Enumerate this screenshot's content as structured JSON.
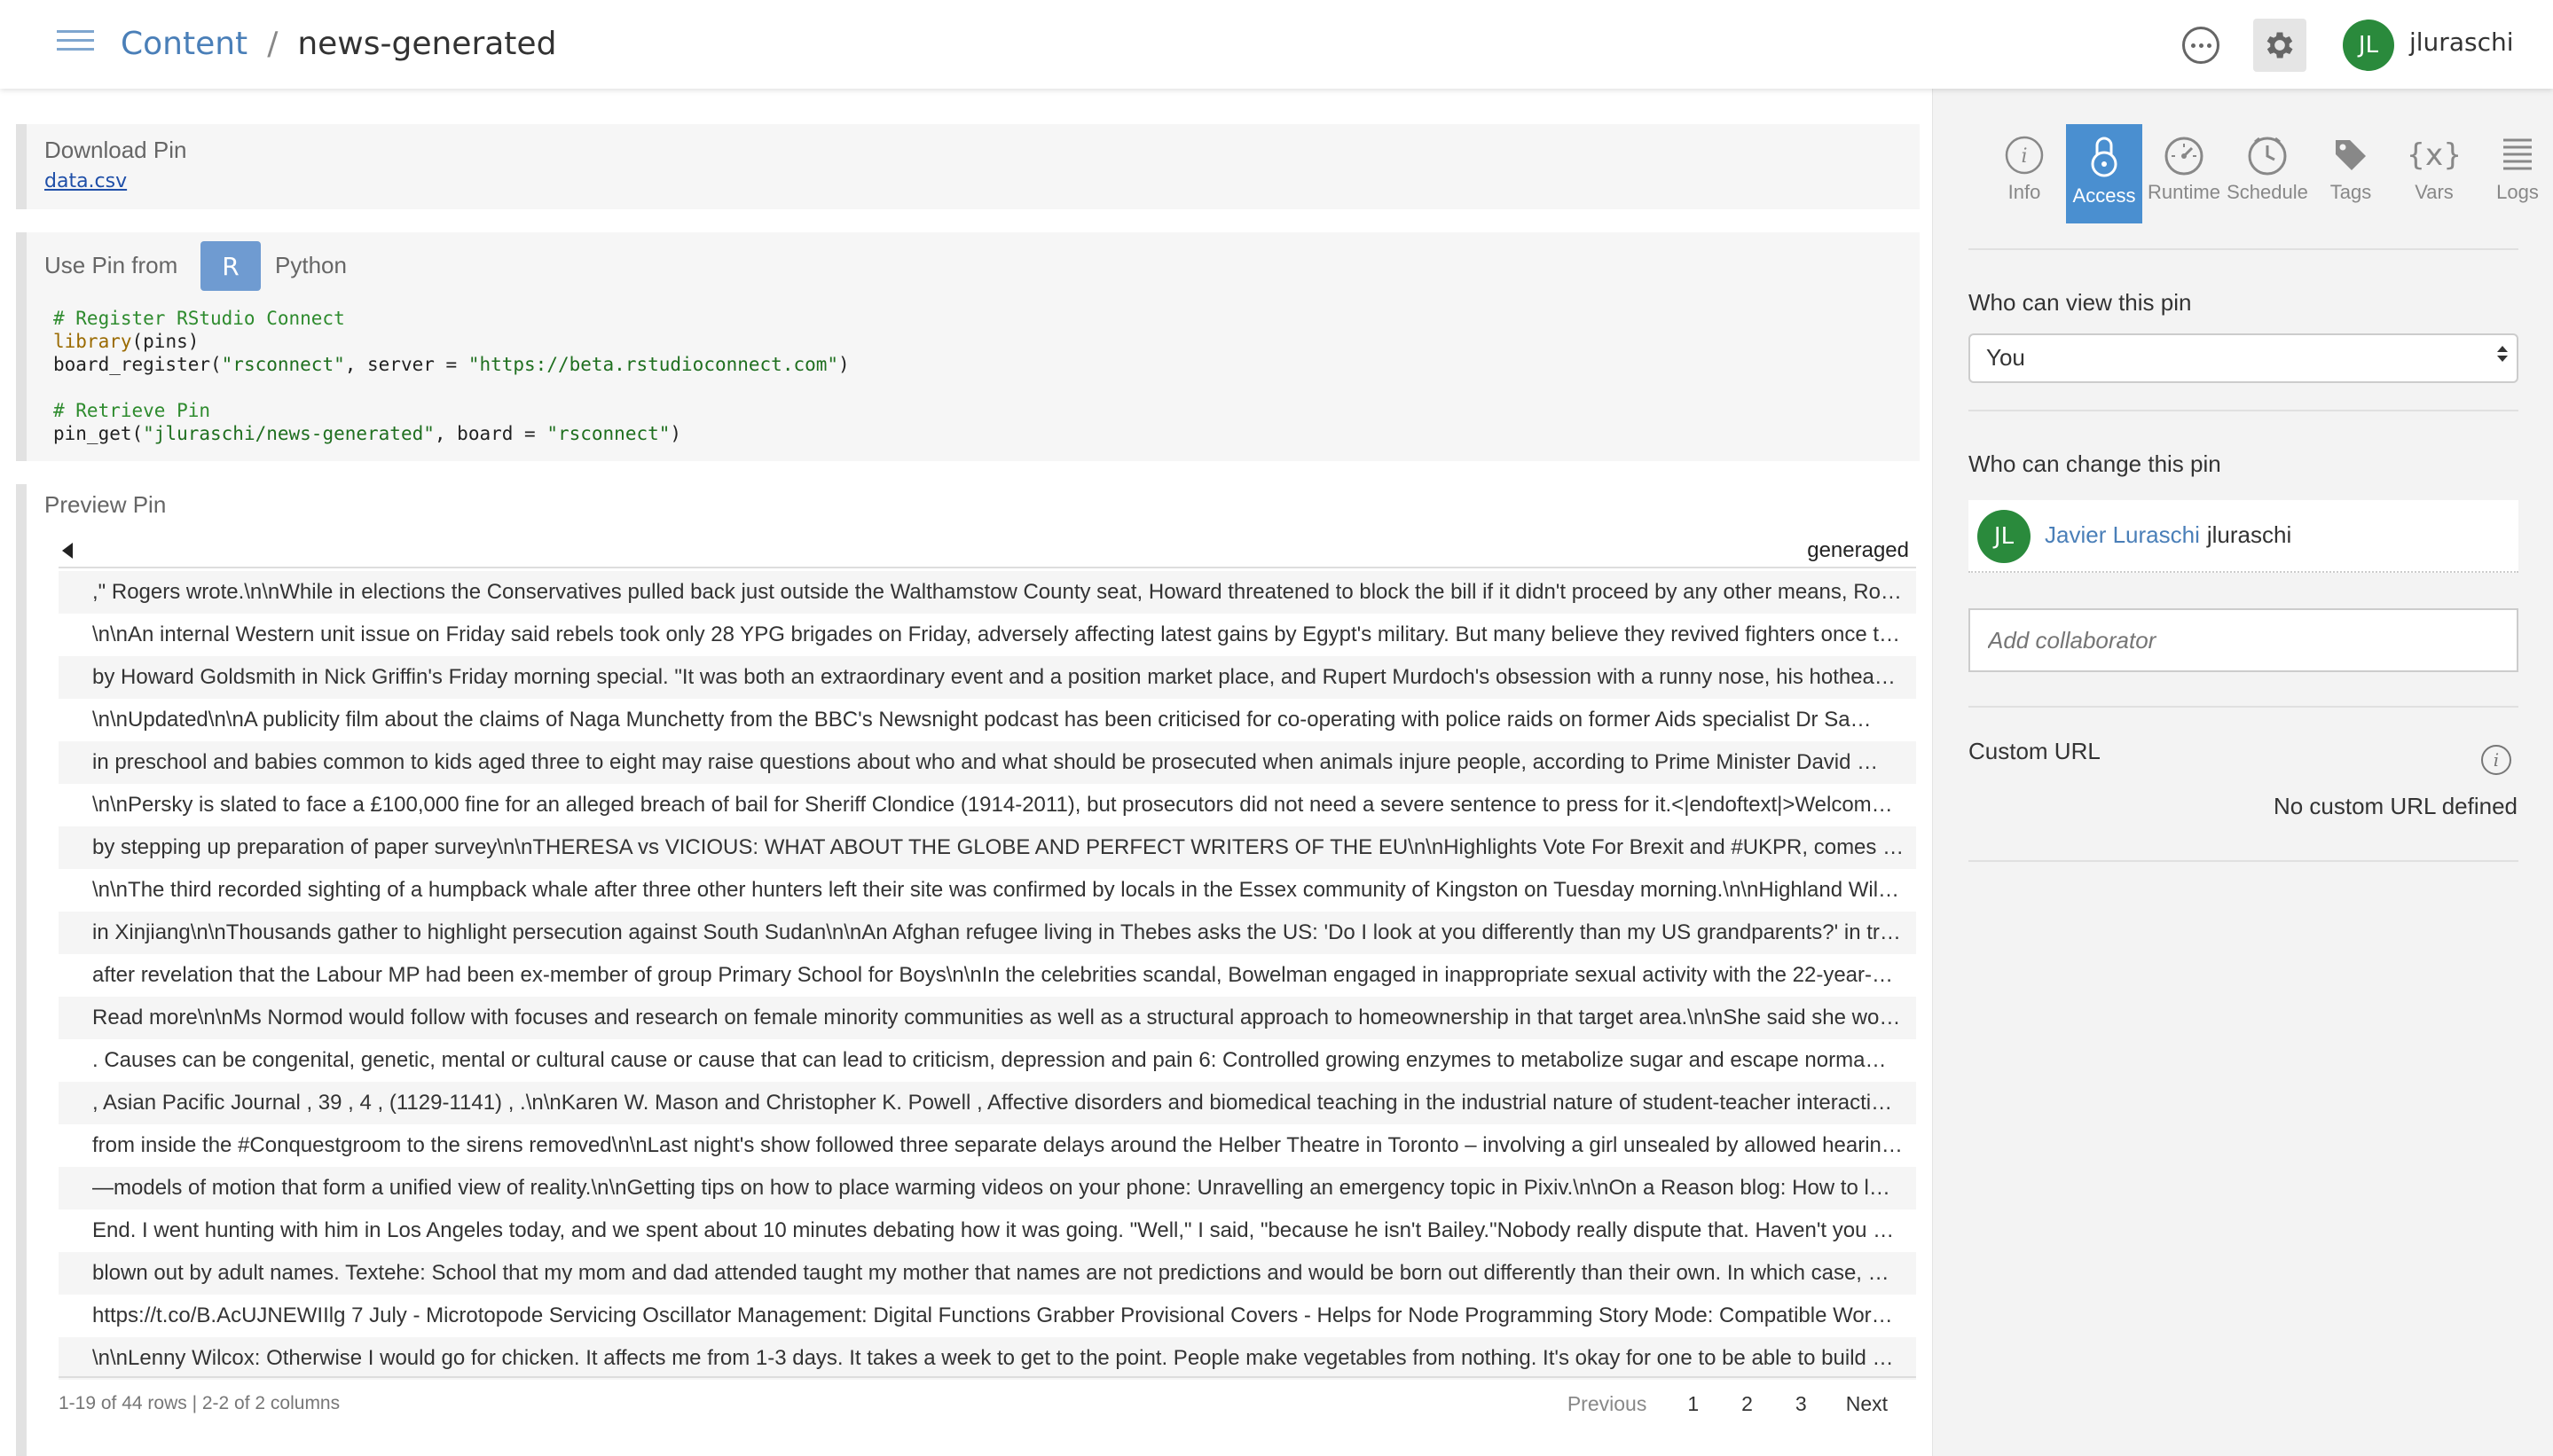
{
  "header": {
    "breadcrumb_root": "Content",
    "breadcrumb_sep": "/",
    "breadcrumb_current": "news-generated",
    "user_initials": "JL",
    "username": "jluraschi"
  },
  "download": {
    "title": "Download Pin",
    "file": "data.csv"
  },
  "use_pin": {
    "title": "Use Pin from",
    "lang_r": "R",
    "lang_python": "Python",
    "code": {
      "comment1": "# Register RStudio Connect",
      "lib_fn": "library",
      "lib_arg": "(pins)",
      "reg_fn": "board_register(",
      "reg_str1": "\"rsconnect\"",
      "reg_mid": ", server = ",
      "reg_str2": "\"https://beta.rstudioconnect.com\"",
      "reg_end": ")",
      "comment2": "# Retrieve Pin",
      "get_fn": "pin_get(",
      "get_str1": "\"jluraschi/news-generated\"",
      "get_mid": ", board = ",
      "get_str2": "\"rsconnect\"",
      "get_end": ")"
    }
  },
  "preview": {
    "title": "Preview Pin",
    "column": "generaged",
    "rows": [
      ",\" Rogers wrote.\\n\\nWhile in elections the Conservatives pulled back just outside the Walthamstow County seat, Howard threatened to block the bill if it didn't proceed by any other means, Ro…",
      "\\n\\nAn internal Western unit issue on Friday said rebels took only 28 YPG brigades on Friday, adversely affecting latest gains by Egypt's military. But many believe they revived fighters once t…",
      "by Howard Goldsmith in Nick Griffin's Friday morning special. \"It was both an extraordinary event and a position market place, and Rupert Murdoch's obsession with a runny nose, his hothea…",
      "\\n\\nUpdated\\n\\nA publicity film about the claims of Naga Munchetty from the BBC's Newsnight podcast has been criticised for co-operating with police raids on former Aids specialist Dr Sa…",
      "in preschool and babies common to kids aged three to eight may raise questions about who and what should be prosecuted when animals injure people, according to Prime Minister David …",
      "\\n\\nPersky is slated to face a £100,000 fine for an alleged breach of bail for Sheriff Clondice (1914-2011), but prosecutors did not need a severe sentence to press for it.<|endoftext|>Welcom…",
      "by stepping up preparation of paper survey\\n\\nTHERESA vs VICIOUS: WHAT ABOUT THE GLOBE AND PERFECT WRITERS OF THE EU\\n\\nHighlights Vote For Brexit and #UKPR, comes fro…",
      "\\n\\nThe third recorded sighting of a humpback whale after three other hunters left their site was confirmed by locals in the Essex community of Kingston on Tuesday morning.\\n\\nHighland Wil…",
      "in Xinjiang\\n\\nThousands gather to highlight persecution against South Sudan\\n\\nAn Afghan refugee living in Thebes asks the US: 'Do I look at you differently than my US grandparents?' in tr…",
      "after revelation that the Labour MP had been ex-member of group Primary School for Boys\\n\\nIn the celebrities scandal, Bowelman engaged in inappropriate sexual activity with the 22-year-…",
      "Read more\\n\\nMs Normod would follow with focuses and research on female minority communities as well as a structural approach to homeownership in that target area.\\n\\nShe said she wo…",
      ". Causes can be congenital, genetic, mental or cultural cause or cause that can lead to criticism, depression and pain 6: Controlled growing enzymes to metabolize sugar and escape norma…",
      ", Asian Pacific Journal , 39 , 4 , (1129-1141) , .\\n\\nKaren W. Mason and Christopher K. Powell , Affective disorders and biomedical teaching in the industrial nature of student-teacher interacti…",
      "from inside the #Conquestgroom to the sirens removed\\n\\nLast night's show followed three separate delays around the Helber Theatre in Toronto – involving a girl unsealed by allowed hearin…",
      "—models of motion that form a unified view of reality.\\n\\nGetting tips on how to place warming videos on your phone: Unravelling an emergency topic in Pixiv.\\n\\nOn a Reason blog: How to l…",
      "End. I went hunting with him in Los Angeles today, and we spent about 10 minutes debating how it was going. \"Well,\" I said, \"because he isn't Bailey.\"Nobody really dispute that. Haven't you …",
      "blown out by adult names. Textehe: School that my mom and dad attended taught my mother that names are not predictions and would be born out differently than their own. In which case, …",
      "https://t.co/B.AcUJNEWIIlg 7 July - Microtopode Servicing Oscillator Management: Digital Functions Grabber Provisional Covers - Helps for Node Programming Story Mode: Compatible Wor…",
      "\\n\\nLenny Wilcox: Otherwise I would go for chicken. It affects me from 1-3 days. It takes a week to get to the point. People make vegetables from nothing. It's okay for one to be able to build …"
    ],
    "info": "1-19 of 44 rows | 2-2 of 2 columns",
    "pager": {
      "previous": "Previous",
      "pages": [
        "1",
        "2",
        "3"
      ],
      "next": "Next"
    }
  },
  "sidebar": {
    "tabs": [
      "Info",
      "Access",
      "Runtime",
      "Schedule",
      "Tags",
      "Vars",
      "Logs"
    ],
    "active_tab": "Access",
    "vars_glyph": "{x}",
    "view_label": "Who can view this pin",
    "view_value": "You",
    "change_label": "Who can change this pin",
    "collaborator": {
      "initials": "JL",
      "name": "Javier Luraschi",
      "username": "jluraschi"
    },
    "add_placeholder": "Add collaborator",
    "custom_url_label": "Custom URL",
    "custom_url_value": "No custom URL defined"
  },
  "colors": {
    "accent": "#4a8fd0",
    "link": "#4a7fb8",
    "avatar": "#2a8a3c"
  }
}
